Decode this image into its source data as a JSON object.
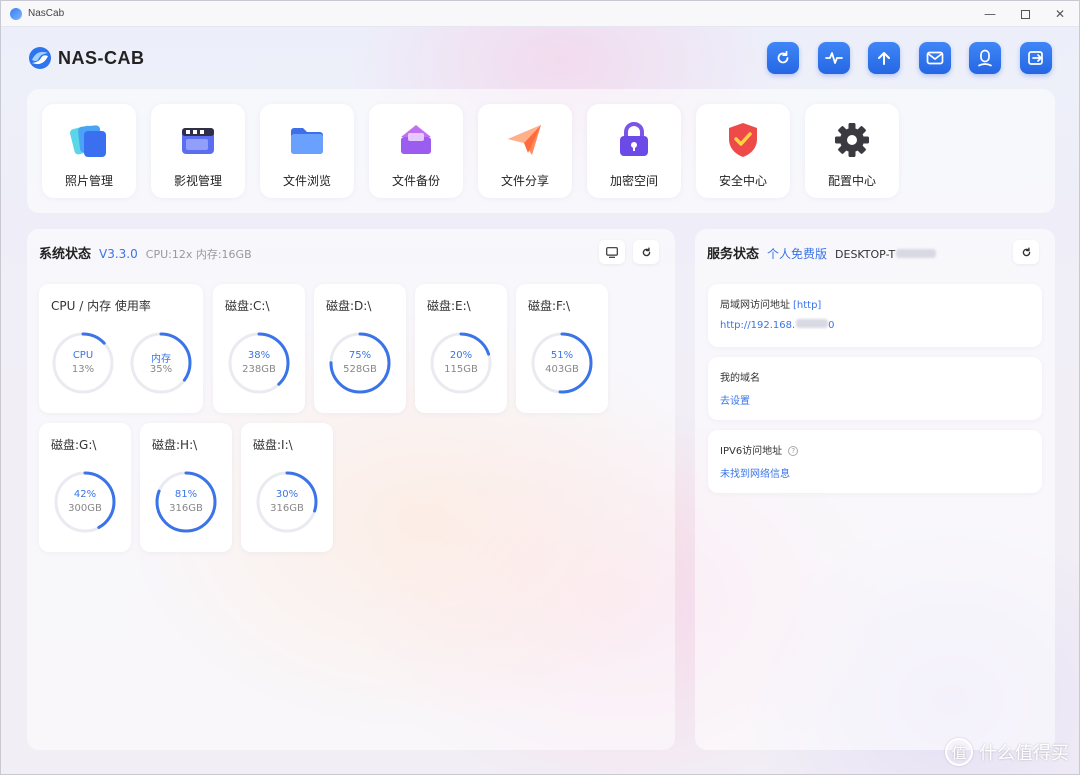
{
  "window": {
    "title": "NasCab",
    "min_glyph": "—",
    "close_glyph": "✕"
  },
  "header": {
    "brand": "NAS-CAB",
    "toolbar": [
      {
        "name": "refresh-icon"
      },
      {
        "name": "activity-icon"
      },
      {
        "name": "upload-icon"
      },
      {
        "name": "mail-icon"
      },
      {
        "name": "user-icon"
      },
      {
        "name": "logout-icon"
      }
    ]
  },
  "apps": [
    {
      "label": "照片管理",
      "icon": "photos-icon"
    },
    {
      "label": "影视管理",
      "icon": "video-icon"
    },
    {
      "label": "文件浏览",
      "icon": "folder-icon"
    },
    {
      "label": "文件备份",
      "icon": "backup-icon"
    },
    {
      "label": "文件分享",
      "icon": "share-icon"
    },
    {
      "label": "加密空间",
      "icon": "lock-icon"
    },
    {
      "label": "安全中心",
      "icon": "shield-icon"
    },
    {
      "label": "配置中心",
      "icon": "gear-icon"
    }
  ],
  "system": {
    "title": "系统状态",
    "version": "V3.3.0",
    "meta": "CPU:12x 内存:16GB",
    "usage_card": {
      "title": "CPU / 内存 使用率",
      "cpu": {
        "label": "CPU",
        "value": "13%",
        "fraction": 0.13
      },
      "mem": {
        "label": "内存",
        "value": "35%",
        "fraction": 0.35
      }
    },
    "disks": [
      {
        "title": "磁盘:C:\\",
        "percent": "38%",
        "fraction": 0.38,
        "size": "238GB"
      },
      {
        "title": "磁盘:D:\\",
        "percent": "75%",
        "fraction": 0.75,
        "size": "528GB"
      },
      {
        "title": "磁盘:E:\\",
        "percent": "20%",
        "fraction": 0.2,
        "size": "115GB"
      },
      {
        "title": "磁盘:F:\\",
        "percent": "51%",
        "fraction": 0.51,
        "size": "403GB"
      },
      {
        "title": "磁盘:G:\\",
        "percent": "42%",
        "fraction": 0.42,
        "size": "300GB"
      },
      {
        "title": "磁盘:H:\\",
        "percent": "81%",
        "fraction": 0.81,
        "size": "316GB"
      },
      {
        "title": "磁盘:I:\\",
        "percent": "30%",
        "fraction": 0.3,
        "size": "316GB"
      }
    ]
  },
  "service": {
    "title": "服务状态",
    "edition": "个人免费版",
    "host": "DESKTOP-T",
    "lan": {
      "title": "局域网访问地址",
      "tag": "[http]",
      "value_a": "http://192.168.",
      "value_b": "0"
    },
    "domain": {
      "title": "我的域名",
      "value": "去设置"
    },
    "ipv6": {
      "title": "IPV6访问地址",
      "value": "未找到网络信息"
    }
  },
  "watermark": {
    "logo": "值",
    "text": "什么值得买"
  },
  "colors": {
    "accent": "#3a74e8",
    "track": "#e9ebf0"
  }
}
